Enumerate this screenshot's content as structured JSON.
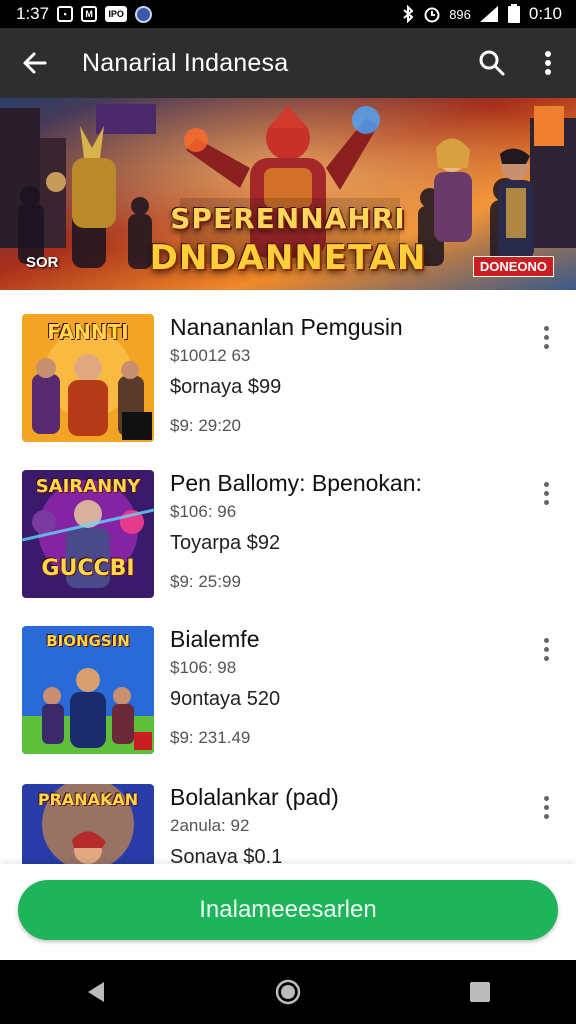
{
  "status_bar": {
    "time": "1:37",
    "right_time": "0:10",
    "icons_left": [
      "app-box-icon",
      "app-box-icon",
      "notification-icon",
      "browser-icon"
    ],
    "icons_right": [
      "bluetooth-icon",
      "alarm-icon",
      "nfc-icon",
      "signal-icon",
      "battery-icon"
    ],
    "small_labels": {
      "badge_a": "M",
      "badge_b": "IPO",
      "network": "896"
    }
  },
  "app_bar": {
    "title": "Nanarial Indanesa",
    "icons": [
      "back-arrow-icon",
      "search-icon",
      "more-vert-icon"
    ]
  },
  "banner": {
    "title_line1": "SPERENNAHRI",
    "title_line2": "DNDANNETAN",
    "tag_left": "SOR",
    "tag_right": "DONEONO"
  },
  "list": {
    "items": [
      {
        "name": "Nanananlan Pemgusin",
        "line1": "$10012 63",
        "line2": "$ornaya $99",
        "line3": "$9: 29:20",
        "thumb_label": "FANNTI",
        "thumb_colors": [
          "#f4a424",
          "#b53a18",
          "#5a2a70"
        ]
      },
      {
        "name": "Pen Ballomy: Bpenokan:",
        "line1": "$106: 96",
        "line2": "Toyarpa $92",
        "line3": "$9: 25:99",
        "thumb_label": "GUCCBI",
        "thumb_colors": [
          "#b52cc9",
          "#3a1a6a",
          "#e83a8a"
        ]
      },
      {
        "name": "Bialemfe",
        "line1": "$106: 98",
        "line2": "9ontaya 520",
        "line3": "$9: 231.49",
        "thumb_label": "BIONGSIN",
        "thumb_colors": [
          "#2a6ad8",
          "#5fbf3a",
          "#1b2a6a"
        ]
      },
      {
        "name": "Bolalankar (pad)",
        "line1": "2anula: 92",
        "line2": "Sonaya $0.1",
        "line3": "",
        "thumb_label": "PRANAKAN",
        "thumb_colors": [
          "#2a3ca8",
          "#f0a030",
          "#b52a2a"
        ]
      }
    ]
  },
  "cta": {
    "label": "Inalameeesarlen",
    "color": "#1fb45a"
  },
  "nav_bar": {
    "icons": [
      "nav-back-icon",
      "nav-home-icon",
      "nav-recents-icon"
    ]
  }
}
